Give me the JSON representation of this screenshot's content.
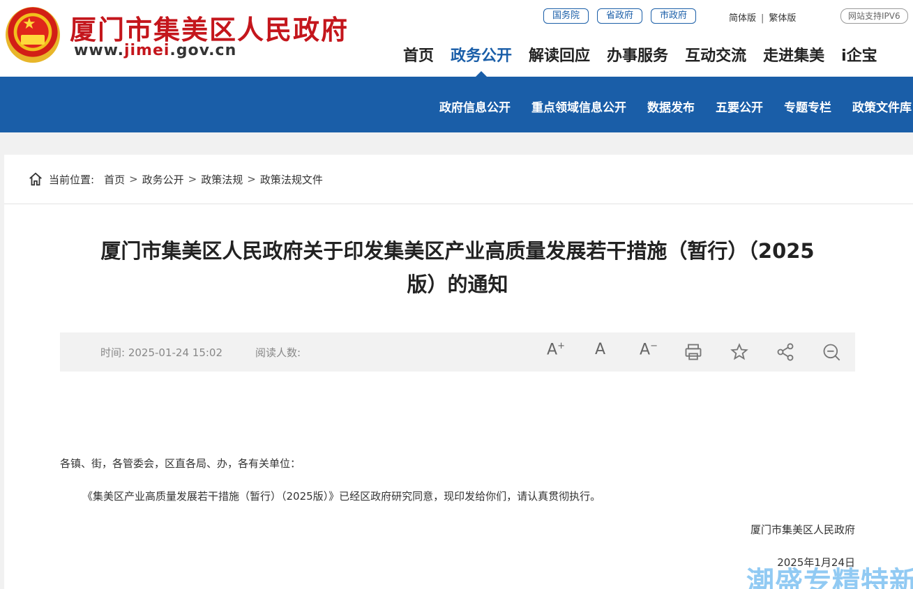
{
  "header": {
    "site_title": "厦门市集美区人民政府",
    "site_url_prefix": "www.",
    "site_url_highlight": "jimei",
    "site_url_suffix": ".gov.cn",
    "top_links": [
      "国务院",
      "省政府",
      "市政府"
    ],
    "lang_simplified": "简体版",
    "lang_separator": "|",
    "lang_traditional": "繁体版",
    "ipv6_badge": "网站支持IPV6"
  },
  "main_nav": {
    "items": [
      "首页",
      "政务公开",
      "解读回应",
      "办事服务",
      "互动交流",
      "走进集美",
      "i企宝"
    ],
    "active": "政务公开"
  },
  "sub_nav": {
    "items": [
      "政府信息公开",
      "重点领域信息公开",
      "数据发布",
      "五要公开",
      "专题专栏",
      "政策文件库"
    ]
  },
  "breadcrumb": {
    "label": "当前位置:",
    "items": [
      "首页",
      "政务公开",
      "政策法规",
      "政策法规文件"
    ],
    "separator": ">"
  },
  "article": {
    "title_line1": "厦门市集美区人民政府关于印发集美区产业高质量发展若干措施（暂行）（2025",
    "title_line2": "版）的通知",
    "time_label": "时间:",
    "time_value": "2025-01-24 15:02",
    "readers_label": "阅读人数:",
    "tools": {
      "font_larger": "A",
      "font_larger_sup": "+",
      "font_normal": "A",
      "font_smaller": "A",
      "font_smaller_sup": "−"
    },
    "salutation": "各镇、街，各管委会，区直各局、办，各有关单位：",
    "paragraph1": "《集美区产业高质量发展若干措施（暂行）（2025版）》已经区政府研究同意，现印发给你们，请认真贯彻执行。",
    "signature": "厦门市集美区人民政府",
    "date": "2025年1月24日"
  },
  "watermark": "潮盛专精特新",
  "colors": {
    "brand_blue": "#1a5ea8",
    "brand_red": "#c4161c"
  }
}
